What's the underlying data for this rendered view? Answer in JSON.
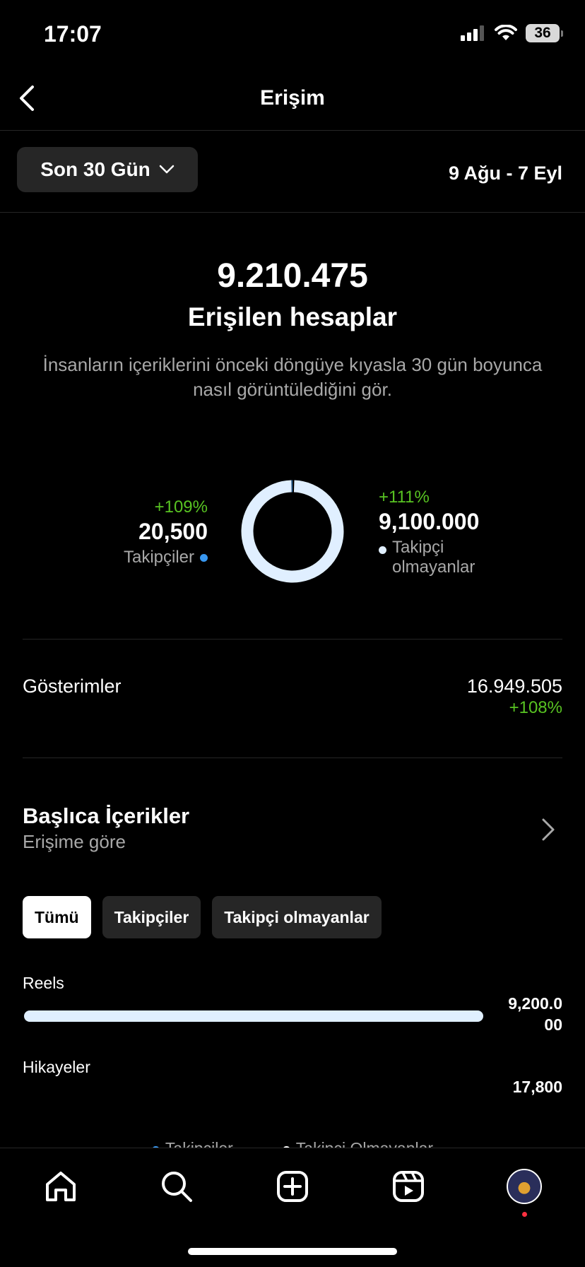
{
  "status_bar": {
    "time": "17:07",
    "battery": "36"
  },
  "header": {
    "title": "Erişim"
  },
  "filter": {
    "period_label": "Son 30 Gün",
    "date_range": "9 Ağu - 7 Eyl"
  },
  "summary": {
    "accounts_reached": "9.210.475",
    "label": "Erişilen hesaplar",
    "description": "İnsanların içeriklerini önceki döngüye kıyasla 30 gün boyunca nasıl görüntülediğini gör."
  },
  "donut": {
    "followers": {
      "change": "+109%",
      "value": "20,500",
      "label": "Takipçiler",
      "color": "#3897f0",
      "raw": 20500
    },
    "non_followers": {
      "change": "+111%",
      "value": "9,100.000",
      "label_line1": "Takipçi",
      "label_line2": "olmayanlar",
      "color": "#e0efff",
      "raw": 9100000
    }
  },
  "impressions": {
    "label": "Gösterimler",
    "value": "16.949.505",
    "change": "+108%"
  },
  "top_content": {
    "title": "Başlıca İçerikler",
    "subtitle": "Erişime göre",
    "chips": [
      {
        "label": "Tümü",
        "active": true
      },
      {
        "label": "Takipçiler",
        "active": false
      },
      {
        "label": "Takipçi olmayanlar",
        "active": false
      }
    ],
    "rows": [
      {
        "label": "Reels",
        "value_line1": "9,200.0",
        "value_line2": "00",
        "fraction": 1.0
      },
      {
        "label": "Hikayeler",
        "value_line1": "17,800",
        "value_line2": "",
        "fraction": 0.0019
      }
    ],
    "legend": [
      {
        "label": "Takipçiler",
        "color": "#3897f0"
      },
      {
        "label": "Takipçi Olmayanlar",
        "color": "#ffffff"
      }
    ]
  },
  "tabbar": {
    "icons": [
      "home-icon",
      "search-icon",
      "create-icon",
      "reels-icon",
      "profile-avatar"
    ]
  }
}
